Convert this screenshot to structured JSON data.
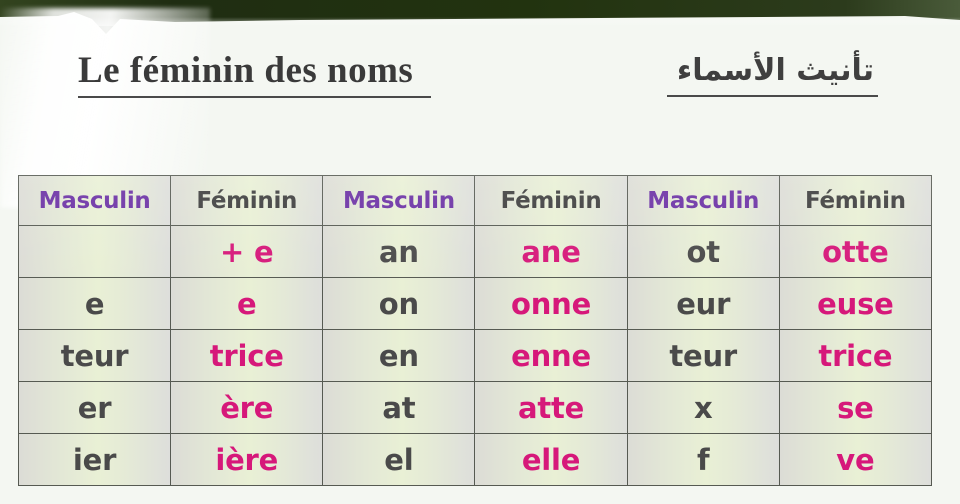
{
  "page": {
    "background_color": "#f4f7f2",
    "accent_band_color": "#26381a",
    "masculine_header_color": "#6a2fa4",
    "feminine_header_color": "#3d3d3d",
    "masculine_cell_color": "#4a4a4a",
    "feminine_cell_color": "#d6187a"
  },
  "titles": {
    "french": "Le féminin des noms",
    "arabic": "تأنيث الأسماء"
  },
  "table": {
    "column_headers": [
      "Masculin",
      "Féminin",
      "Masculin",
      "Féminin",
      "Masculin",
      "Féminin"
    ],
    "rows": [
      [
        "",
        "+ e",
        "an",
        "ane",
        "ot",
        "otte"
      ],
      [
        "e",
        "e",
        "on",
        "onne",
        "eur",
        "euse"
      ],
      [
        "teur",
        "trice",
        "en",
        "enne",
        "teur",
        "trice"
      ],
      [
        "er",
        "ère",
        "at",
        "atte",
        "x",
        "se"
      ],
      [
        "ier",
        "ière",
        "el",
        "elle",
        "f",
        "ve"
      ]
    ]
  }
}
